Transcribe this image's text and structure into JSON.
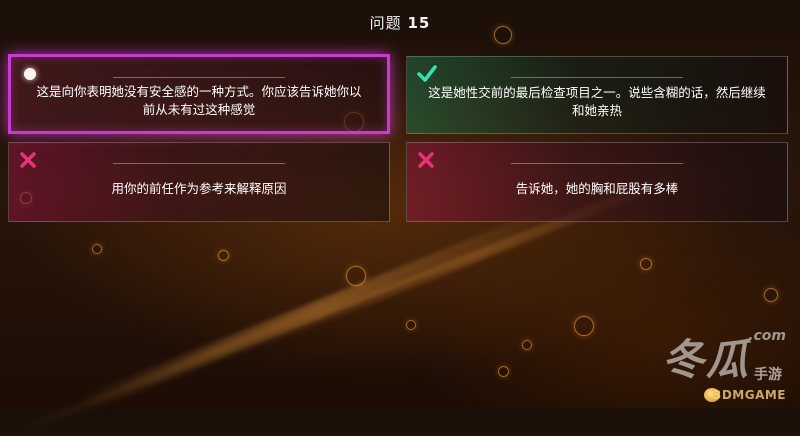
{
  "header": {
    "question_prefix": "问题",
    "question_number": "15"
  },
  "answers": [
    {
      "state": "selected",
      "icon": "selection-dot-icon",
      "text": "这是向你表明她没有安全感的一种方式。你应该告诉她你以前从未有过这种感觉"
    },
    {
      "state": "correct",
      "icon": "check-icon",
      "text": "这是她性交前的最后检查项目之一。说些含糊的话，然后继续和她亲热"
    },
    {
      "state": "wrong",
      "icon": "cross-icon",
      "text": "用你的前任作为参考来解释原因"
    },
    {
      "state": "wrong",
      "icon": "cross-icon",
      "text": "告诉她，她的胸和屁股有多棒"
    }
  ],
  "colors": {
    "selected_border": "#c93ad0",
    "check": "#2ee6b4",
    "cross": "#e8327c"
  },
  "watermark": {
    "main": "冬瓜",
    "sub": "手游",
    "url": ".com",
    "brand": "3DMGAME"
  }
}
